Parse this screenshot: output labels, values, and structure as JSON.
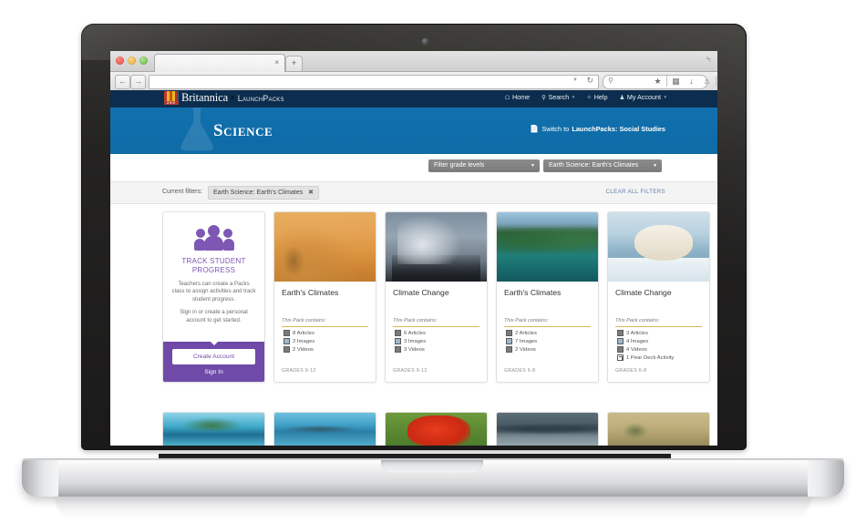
{
  "browser": {
    "traffic_lights": [
      "close-red",
      "minimize-yellow",
      "maximize-green"
    ],
    "tab_close": "×",
    "tab_new": "+",
    "back_icon": "←",
    "forward_icon": "→",
    "url_value": "",
    "url_dropdown_caret": "▼",
    "reload_icon": "↻",
    "search_placeholder": "",
    "search_icon": "⚲",
    "toolbar_icons": [
      "★",
      "☰",
      "↓",
      "⌂",
      "≡"
    ]
  },
  "topbar": {
    "brand_name": "Britannica",
    "brand_trademark": "®",
    "brand_product": "LaunchPacks",
    "brand_product_tm": "®",
    "logo_number": "250",
    "nav": [
      {
        "label": "Home",
        "icon": "🏠",
        "caret": false
      },
      {
        "label": "Search",
        "icon": "🔍",
        "caret": true
      },
      {
        "label": "Help",
        "icon": "💡",
        "caret": false
      },
      {
        "label": "My Account",
        "icon": "👤",
        "caret": true
      }
    ]
  },
  "hero": {
    "title": "Science",
    "switch_prefix": "Switch to ",
    "switch_target": "LaunchPacks: Social Studies",
    "switch_icon": "switch-icon"
  },
  "filters": {
    "grade_dropdown": "Filter grade levels",
    "topic_dropdown": "Earth Science: Earth's Climates",
    "caret": "▼",
    "current_label": "Current filters:",
    "current_chip": "Earth Science: Earth's Climates",
    "chip_remove": "✖",
    "clear_all": "CLEAR ALL FILTERS"
  },
  "promo": {
    "heading": "TRACK STUDENT PROGRESS",
    "body1": "Teachers can create a Packs class to assign activities and track student progress.",
    "body2": "Sign in or create a personal account to get started.",
    "create_account": "Create Account",
    "sign_in": "Sign In",
    "accent_color": "#6f4aa8"
  },
  "cards": [
    {
      "title": "Earth's Climates",
      "contains_label": "This Pack contains:",
      "items": [
        {
          "count": "8 Articles",
          "icon": "document-icon",
          "kind": "doc"
        },
        {
          "count": "2 Images",
          "icon": "image-icon",
          "kind": "img"
        },
        {
          "count": "2 Videos",
          "icon": "video-icon",
          "kind": "doc"
        }
      ],
      "grades": "GRADES 9-12",
      "thumb": "desert-dunes-photo",
      "thumb_class": "ph-desert"
    },
    {
      "title": "Climate Change",
      "contains_label": "This Pack contains:",
      "items": [
        {
          "count": "6 Articles",
          "icon": "document-icon",
          "kind": "doc"
        },
        {
          "count": "3 Images",
          "icon": "image-icon",
          "kind": "img"
        },
        {
          "count": "3 Videos",
          "icon": "video-icon",
          "kind": "doc"
        }
      ],
      "grades": "GRADES 9-12",
      "thumb": "smokestacks-photo",
      "thumb_class": "ph-smoke"
    },
    {
      "title": "Earth's Climates",
      "contains_label": "This Pack contains:",
      "items": [
        {
          "count": "2 Articles",
          "icon": "document-icon",
          "kind": "doc"
        },
        {
          "count": "7 Images",
          "icon": "image-icon",
          "kind": "img"
        },
        {
          "count": "2 Videos",
          "icon": "video-icon",
          "kind": "doc"
        }
      ],
      "grades": "GRADES 6-8",
      "thumb": "mountain-forest-lake-photo",
      "thumb_class": "ph-forest"
    },
    {
      "title": "Climate Change",
      "contains_label": "This Pack contains:",
      "items": [
        {
          "count": "3 Articles",
          "icon": "document-icon",
          "kind": "doc"
        },
        {
          "count": "4 Images",
          "icon": "image-icon",
          "kind": "img"
        },
        {
          "count": "4 Videos",
          "icon": "video-icon",
          "kind": "doc"
        },
        {
          "count": "1 Pear Deck Activity",
          "icon": "external-link-icon",
          "kind": "lnk"
        }
      ],
      "grades": "GRADES 6-8",
      "thumb": "polar-bear-ice-photo",
      "thumb_class": "ph-bear"
    }
  ],
  "second_row": [
    {
      "thumb": "tropical-beach-photo",
      "thumb_class": "ph-beach"
    },
    {
      "thumb": "island-sea-photo",
      "thumb_class": "ph-island"
    },
    {
      "thumb": "scarlet-macaw-photo",
      "thumb_class": "ph-parrot"
    },
    {
      "thumb": "canyon-river-photo",
      "thumb_class": "ph-canyon"
    },
    {
      "thumb": "savanna-shrubland-photo",
      "thumb_class": "ph-savanna"
    }
  ]
}
